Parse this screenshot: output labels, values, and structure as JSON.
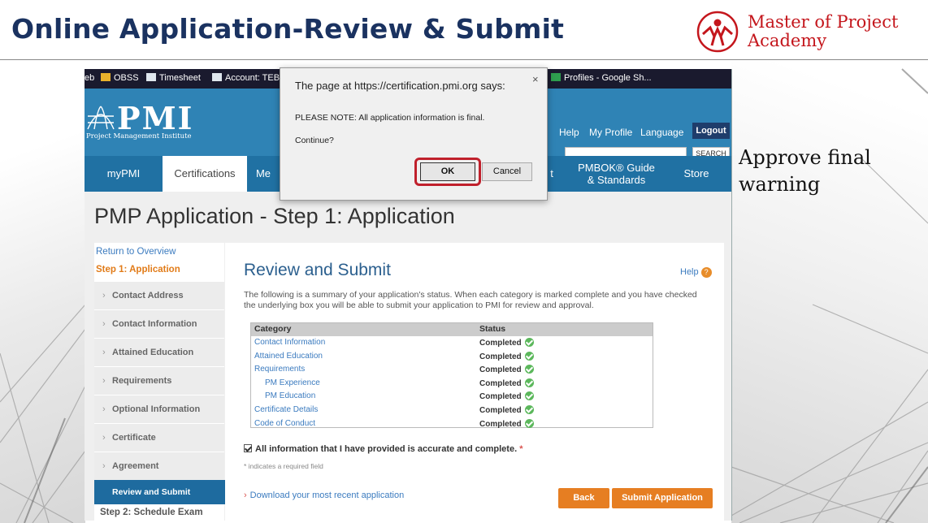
{
  "slide": {
    "title": "Online Application-Review & Submit",
    "annotation_line1": "Approve final",
    "annotation_line2": "warning"
  },
  "logo": {
    "line1": "Master of Project",
    "line2": "Academy",
    "color": "#c4161c"
  },
  "bookmarks": {
    "items": [
      "eb",
      "OBSS",
      "Timesheet",
      "Account: TEB",
      "Profiles - Google Sh..."
    ]
  },
  "pmi": {
    "logo_word": "PMI",
    "logo_sub": "Project Management Institute",
    "links": [
      "Help",
      "My Profile",
      "Language"
    ],
    "logout": "Logout",
    "search_button": "SEARCH"
  },
  "nav": {
    "items": [
      "myPMI",
      "Certifications",
      "Me",
      "t",
      "PMBOK® Guide",
      "& Standards",
      "Store"
    ]
  },
  "page": {
    "heading": "PMP Application - Step 1: Application"
  },
  "sidebar": {
    "return": "Return to Overview",
    "step1": "Step 1: Application",
    "items": [
      "Contact Address",
      "Contact Information",
      "Attained Education",
      "Requirements",
      "Optional Information",
      "Certificate",
      "Agreement"
    ],
    "active": "Review and Submit",
    "step2": "Step 2: Schedule Exam"
  },
  "content": {
    "title": "Review and Submit",
    "help": "Help",
    "intro": "The following is a summary of your application's status. When each category is marked complete and you have checked the underlying box you will be able to submit your application to PMI for review and approval.",
    "table": {
      "headers": [
        "Category",
        "Status"
      ],
      "rows": [
        {
          "category": "Contact Information",
          "status": "Completed"
        },
        {
          "category": "Attained Education",
          "status": "Completed"
        },
        {
          "category": "Requirements",
          "status": "Completed"
        },
        {
          "category": "PM Experience",
          "status": "Completed"
        },
        {
          "category": "PM Education",
          "status": "Completed"
        },
        {
          "category": "Certificate Details",
          "status": "Completed"
        },
        {
          "category": "Code of Conduct",
          "status": "Completed"
        }
      ]
    },
    "confirm": "All information that I have provided is accurate and complete.",
    "required_star": "*",
    "required_note": "* indicates a required field",
    "download": "Download your most recent application",
    "back": "Back",
    "submit": "Submit Application"
  },
  "dialog": {
    "title": "The page at https://certification.pmi.org says:",
    "close": "×",
    "message": "PLEASE NOTE: All application information is final.",
    "question": "Continue?",
    "ok": "OK",
    "cancel": "Cancel"
  },
  "colors": {
    "title_navy": "#1a3260",
    "pmi_blue": "#2f83b5",
    "nav_blue": "#2071a3",
    "accent_orange": "#e67e22",
    "highlight_red": "#c0202c"
  }
}
